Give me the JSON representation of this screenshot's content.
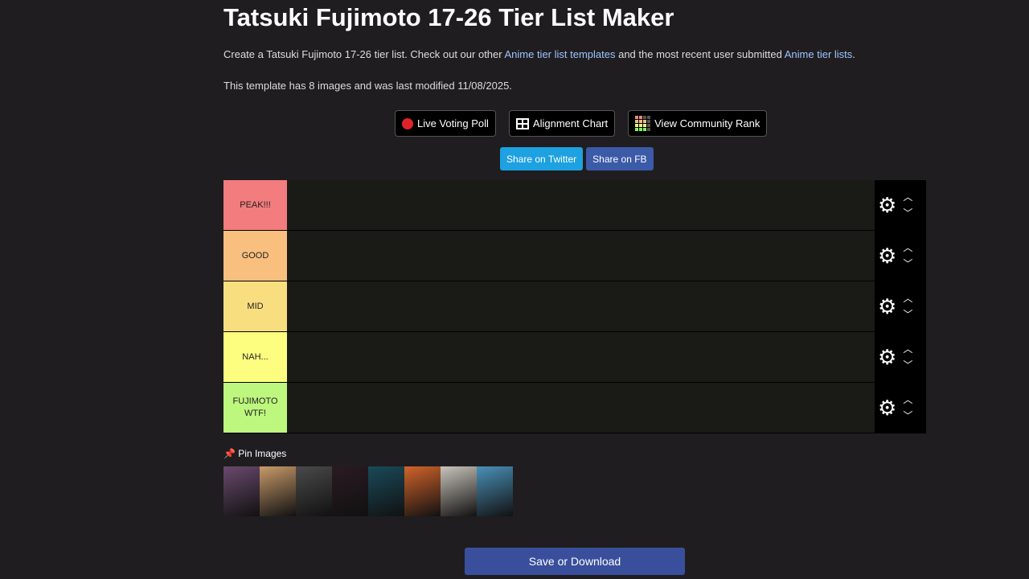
{
  "title": "Tatsuki Fujimoto 17-26 Tier List Maker",
  "intro": {
    "before": "Create a Tatsuki Fujimoto 17-26 tier list. Check out our other ",
    "link1": "Anime tier list templates",
    "middle": " and the most recent user submitted ",
    "link2": "Anime tier lists",
    "end": "."
  },
  "meta": "This template has 8 images and was last modified 11/08/2025.",
  "buttons": {
    "poll": "Live Voting Poll",
    "alignment": "Alignment Chart",
    "community": "View Community Rank"
  },
  "share": {
    "twitter": "Share on Twitter",
    "fb": "Share on FB",
    "twitter_color": "#1da1e0",
    "fb_color": "#3b5aa8"
  },
  "tiers": [
    {
      "label": "PEAK!!!",
      "color": "#f27c7e"
    },
    {
      "label": "GOOD",
      "color": "#f9bf7f"
    },
    {
      "label": "MID",
      "color": "#f9de80"
    },
    {
      "label": "NAH...",
      "color": "#fdfd80"
    },
    {
      "label": "FUJIMOTO WTF!",
      "color": "#bdf77e"
    }
  ],
  "pin_label": "📌 Pin Images",
  "images": [
    {
      "name": "cover-1",
      "color": "#6a4a6e"
    },
    {
      "name": "cover-2",
      "color": "#c89a6a"
    },
    {
      "name": "cover-3",
      "color": "#4a4a4a"
    },
    {
      "name": "cover-4",
      "color": "#2a1a22"
    },
    {
      "name": "cover-5",
      "color": "#1a4a5a"
    },
    {
      "name": "cover-6",
      "color": "#d2632a"
    },
    {
      "name": "cover-7",
      "color": "#c9c4bc"
    },
    {
      "name": "cover-8",
      "color": "#4a90b8"
    }
  ],
  "save": "Save or Download"
}
